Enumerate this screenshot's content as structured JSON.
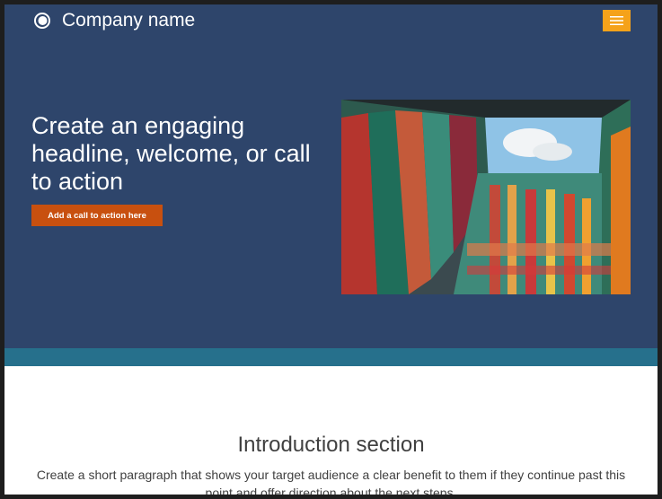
{
  "header": {
    "brand_name": "Company name",
    "logo_icon": "circle-logo-icon",
    "menu_icon": "hamburger-menu-icon"
  },
  "hero": {
    "headline": "Create an engaging headline, welcome, or call to action",
    "cta_label": "Add a call to action here",
    "image": "colorful-building-courtyard-photo"
  },
  "intro": {
    "title": "Introduction section",
    "text": "Create a short paragraph that shows your target audience a clear benefit to them if they continue past this point and offer direction about the next steps."
  },
  "colors": {
    "header_bg": "#2e456b",
    "menu_button": "#f5a21a",
    "cta_button": "#c8500f",
    "stripe": "#26708c"
  }
}
